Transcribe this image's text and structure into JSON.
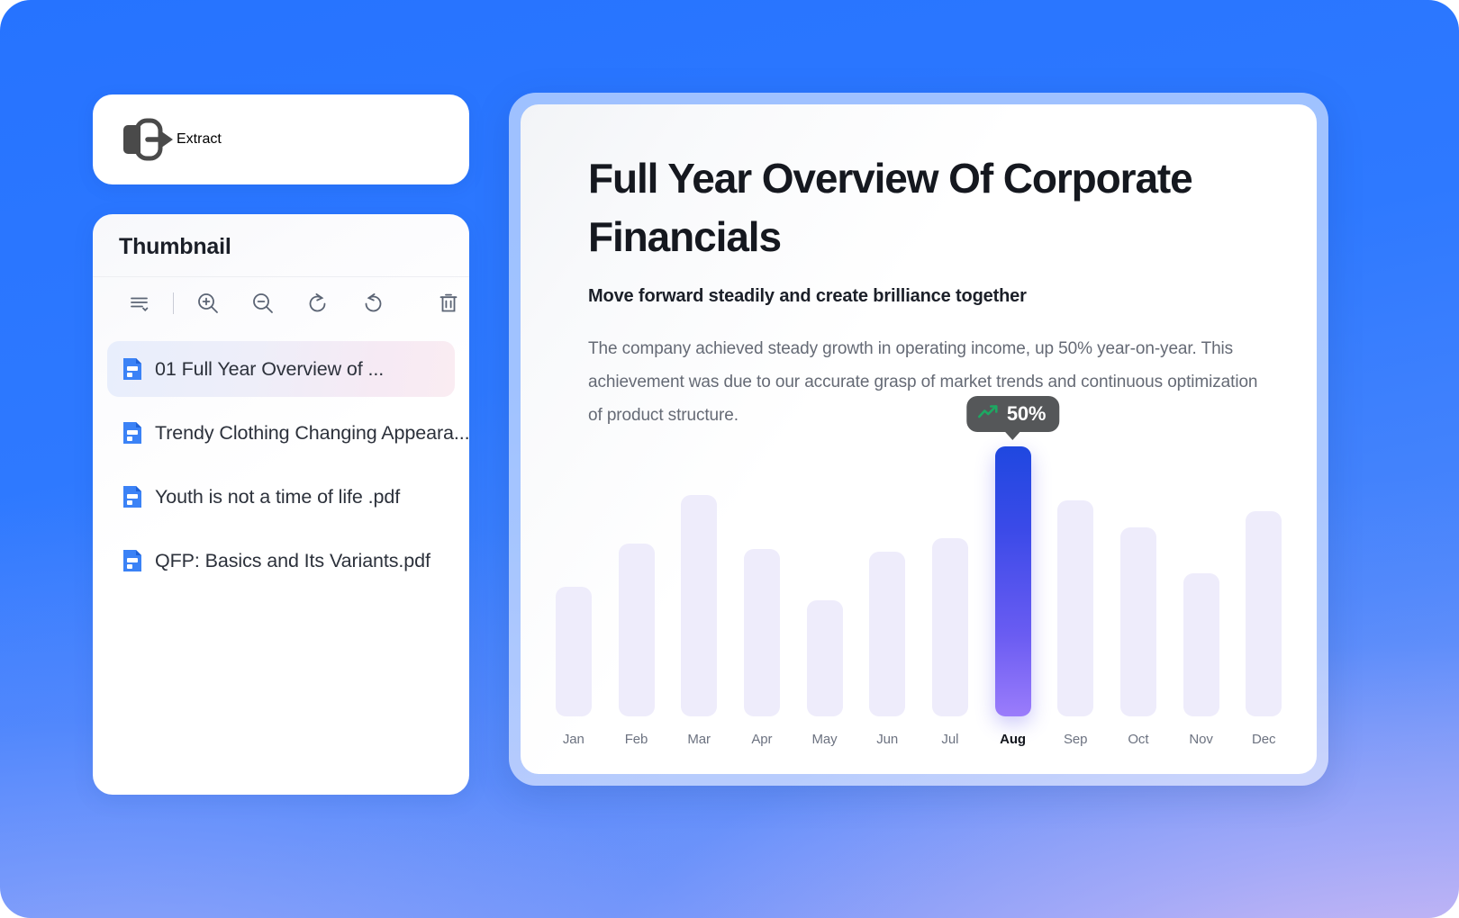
{
  "extract": {
    "label": "Extract",
    "icon": "export-arrow-icon"
  },
  "thumbnail_panel": {
    "title": "Thumbnail",
    "toolbar": [
      {
        "name": "list-view-icon",
        "tooltip": "List view"
      },
      {
        "name": "zoom-in-icon",
        "tooltip": "Zoom in"
      },
      {
        "name": "zoom-out-icon",
        "tooltip": "Zoom out"
      },
      {
        "name": "rotate-left-icon",
        "tooltip": "Rotate left"
      },
      {
        "name": "rotate-right-icon",
        "tooltip": "Rotate right"
      },
      {
        "name": "delete-icon",
        "tooltip": "Delete"
      }
    ],
    "files": [
      {
        "name": "01 Full Year Overview of ...",
        "selected": true
      },
      {
        "name": "Trendy Clothing Changing Appeara......",
        "selected": false
      },
      {
        "name": " Youth is not a time of life .pdf",
        "selected": false
      },
      {
        "name": "QFP: Basics and Its Variants.pdf",
        "selected": false
      }
    ]
  },
  "document": {
    "title": "Full Year Overview Of Corporate Financials",
    "subtitle": "Move forward steadily and create brilliance together",
    "body": "The company achieved steady growth in operating income, up 50% year-on-year. This achievement was due to our accurate grasp of market trends and continuous optimization of product structure."
  },
  "tooltip": {
    "value": "50%",
    "icon": "trending-up-icon",
    "icon_color": "#1DA862",
    "background": "#555759",
    "anchor_category": "Aug"
  },
  "colors": {
    "page_background_start": "#2673FF",
    "page_background_end": "#D4BDF0",
    "bar_inactive": "#EEECFB",
    "bar_active_top": "#1F48E0",
    "bar_active_bottom": "#9B7CFB",
    "file_icon": "#3B82F6",
    "accent_text": "#13161D"
  },
  "chart_data": {
    "type": "bar",
    "title": "",
    "xlabel": "",
    "ylabel": "",
    "categories": [
      "Jan",
      "Feb",
      "Mar",
      "Apr",
      "May",
      "Jun",
      "Jul",
      "Aug",
      "Sep",
      "Oct",
      "Nov",
      "Dec"
    ],
    "values": [
      48,
      64,
      82,
      62,
      43,
      61,
      66,
      100,
      80,
      70,
      53,
      76
    ],
    "ylim": [
      0,
      100
    ],
    "grid": false,
    "legend": "none",
    "highlight_index": 7,
    "highlight_label": "50%"
  }
}
